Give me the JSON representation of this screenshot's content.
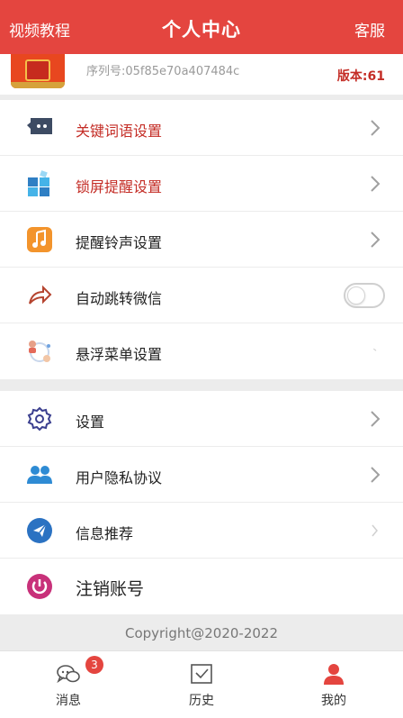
{
  "header": {
    "left_link": "视频教程",
    "title": "个人中心",
    "right_link": "客服"
  },
  "profile": {
    "serial": "序列号:05f85e70a407484c",
    "version": "版本:61"
  },
  "section1": [
    {
      "label": "关键词语设置",
      "icon": "chat-bubble-icon",
      "control": "chevron"
    },
    {
      "label": "锁屏提醒设置",
      "icon": "grid-blocks-icon",
      "control": "chevron"
    },
    {
      "label": "提醒铃声设置",
      "icon": "music-note-icon",
      "control": "chevron"
    },
    {
      "label": "自动跳转微信",
      "icon": "share-arrow-icon",
      "control": "toggle",
      "toggle_on": false
    },
    {
      "label": "悬浮菜单设置",
      "icon": "floating-people-icon",
      "control": "chevron"
    }
  ],
  "section2": [
    {
      "label": "设置",
      "icon": "gear-icon",
      "control": "chevron"
    },
    {
      "label": "用户隐私协议",
      "icon": "users-icon",
      "control": "chevron"
    },
    {
      "label": "信息推荐",
      "icon": "paper-plane-icon",
      "control": "chevron"
    },
    {
      "label": "注销账号",
      "icon": "power-icon",
      "control": "none"
    }
  ],
  "copyright": "Copyright@2020-2022",
  "tabs": [
    {
      "label": "消息",
      "icon": "chat-icon",
      "badge": "3",
      "active": false
    },
    {
      "label": "历史",
      "icon": "mail-history-icon",
      "active": false
    },
    {
      "label": "我的",
      "icon": "person-icon",
      "active": true
    }
  ],
  "colors": {
    "accent": "#e4453f",
    "active_tab_icon": "#e4453f",
    "red_label": "#c42d26"
  }
}
